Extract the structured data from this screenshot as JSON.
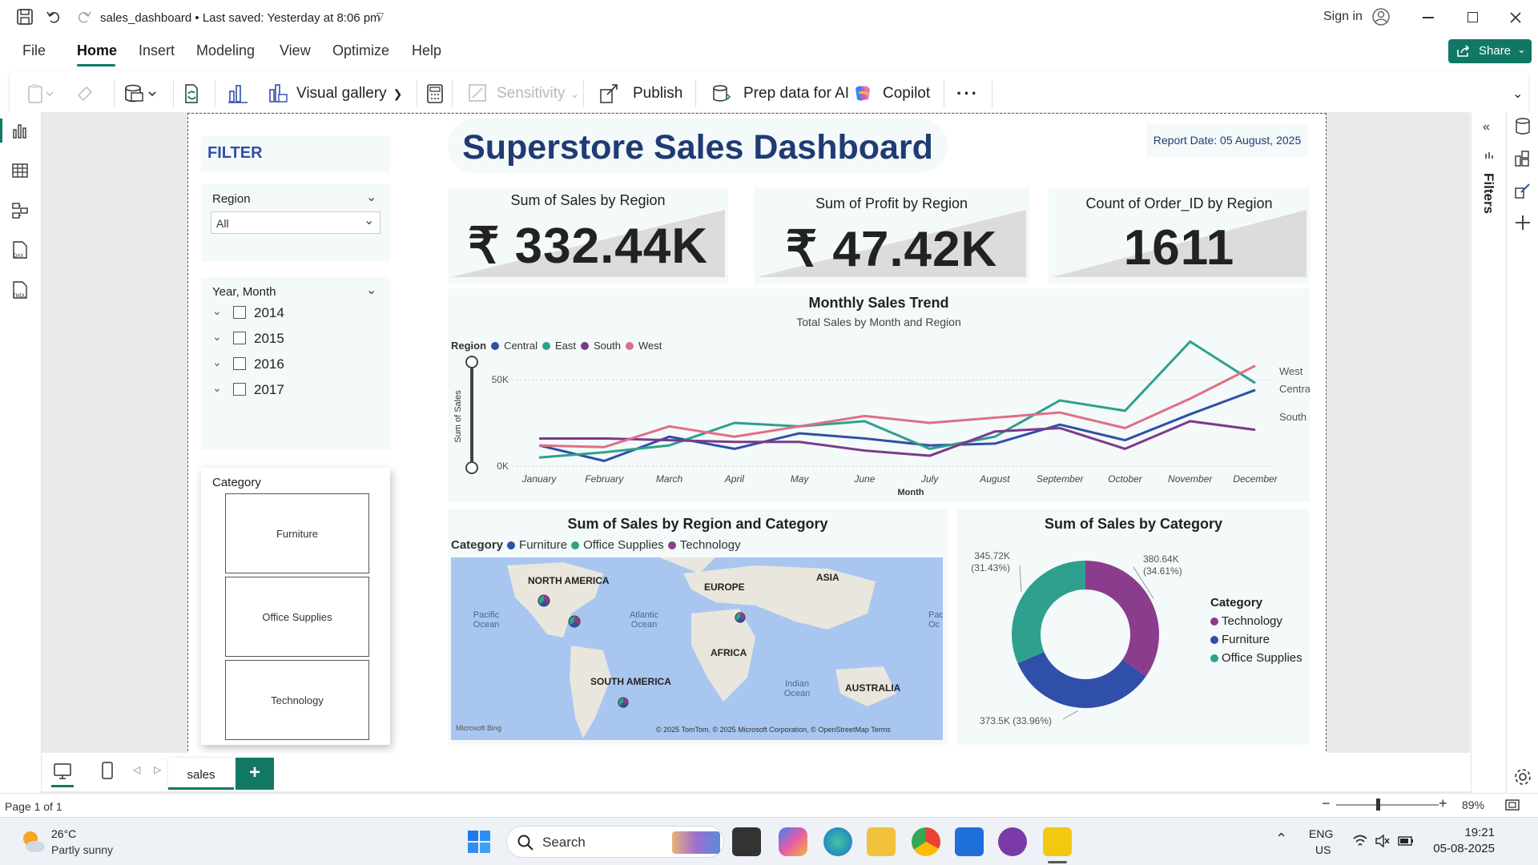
{
  "app": {
    "title": "sales_dashboard • Last saved: Yesterday at 8:06 pm",
    "sign_in": "Sign in",
    "share": "Share"
  },
  "menu": [
    "File",
    "Home",
    "Insert",
    "Modeling",
    "View",
    "Optimize",
    "Help"
  ],
  "ribbon": {
    "visual_gallery": "Visual gallery",
    "sensitivity": "Sensitivity",
    "publish": "Publish",
    "prep_data": "Prep data for AI",
    "copilot": "Copilot"
  },
  "left_nav": [
    "report-view-icon",
    "table-view-icon",
    "model-view-icon",
    "dax-query-icon",
    "tmdl-view-icon"
  ],
  "dashboard": {
    "title": "Superstore Sales Dashboard",
    "report_date": "Report Date: 05 August, 2025",
    "filter_title": "FILTER",
    "region_slicer": {
      "label": "Region",
      "value": "All"
    },
    "year_slicer": {
      "label": "Year, Month",
      "years": [
        "2014",
        "2015",
        "2016",
        "2017"
      ]
    },
    "category_slicer": {
      "label": "Category",
      "items": [
        "Furniture",
        "Office Supplies",
        "Technology"
      ]
    },
    "kpis": [
      {
        "title": "Sum of Sales by Region",
        "value": "₹ 332.44K"
      },
      {
        "title": "Sum of Profit by Region",
        "value": "₹ 47.42K"
      },
      {
        "title": "Count of Order_ID by Region",
        "value": "1611"
      }
    ],
    "map": {
      "title": "Sum of Sales by Region and Category",
      "legend_label": "Category",
      "legend": [
        "Furniture",
        "Office Supplies",
        "Technology"
      ],
      "labels": [
        "NORTH AMERICA",
        "EUROPE",
        "ASIA",
        "AFRICA",
        "SOUTH AMERICA",
        "AUSTRALIA"
      ],
      "oceans": [
        "Pacific Ocean",
        "Atlantic Ocean",
        "Indian Ocean",
        "Pac Oc"
      ],
      "attribution": "© 2025 TomTom, © 2025 Microsoft Corporation, © OpenStreetMap  Terms",
      "brand": "Microsoft Bing"
    }
  },
  "chart_data": [
    {
      "type": "line",
      "title": "Monthly Sales Trend",
      "subtitle": "Total Sales by Month and Region",
      "legend_title": "Region",
      "xlabel": "Month",
      "ylabel": "Sum of Sales",
      "categories": [
        "January",
        "February",
        "March",
        "April",
        "May",
        "June",
        "July",
        "August",
        "September",
        "October",
        "November",
        "December"
      ],
      "y_ticks": [
        "0K",
        "50K"
      ],
      "ylim": [
        0,
        75000
      ],
      "end_labels": [
        "West",
        "Central",
        "South"
      ],
      "series": [
        {
          "name": "Central",
          "color": "#2f4fa8",
          "values": [
            12000,
            3000,
            17000,
            10000,
            19000,
            16000,
            12000,
            13000,
            24000,
            15000,
            30000,
            44000
          ]
        },
        {
          "name": "East",
          "color": "#2fa08e",
          "values": [
            5000,
            8000,
            12000,
            25000,
            23000,
            26000,
            10000,
            17000,
            38000,
            32000,
            72000,
            48000
          ]
        },
        {
          "name": "South",
          "color": "#7b3a8a",
          "values": [
            16000,
            16000,
            15000,
            14000,
            14000,
            9000,
            6000,
            20000,
            22000,
            10000,
            26000,
            21000
          ]
        },
        {
          "name": "West",
          "color": "#df6f86",
          "values": [
            12000,
            11000,
            23000,
            17000,
            23000,
            29000,
            25000,
            28000,
            31000,
            22000,
            39000,
            58000
          ]
        }
      ]
    },
    {
      "type": "pie",
      "title": "Sum of Sales by Category",
      "legend_title": "Category",
      "categories": [
        "Technology",
        "Furniture",
        "Office Supplies"
      ],
      "values": [
        380.64,
        373.5,
        345.72
      ],
      "labels": [
        "380.64K (34.61%)",
        "373.5K (33.96%)",
        "345.72K (31.43%)"
      ],
      "colors": [
        "#8a3d8c",
        "#2f4fa8",
        "#2fa08e"
      ]
    }
  ],
  "page": {
    "tab": "sales",
    "page_info": "Page 1 of 1",
    "zoom": "89%"
  },
  "taskbar": {
    "weather_temp": "26°C",
    "weather_desc": "Partly sunny",
    "search": "Search",
    "lang": "ENG",
    "region": "US",
    "time": "19:21",
    "date": "05-08-2025"
  }
}
